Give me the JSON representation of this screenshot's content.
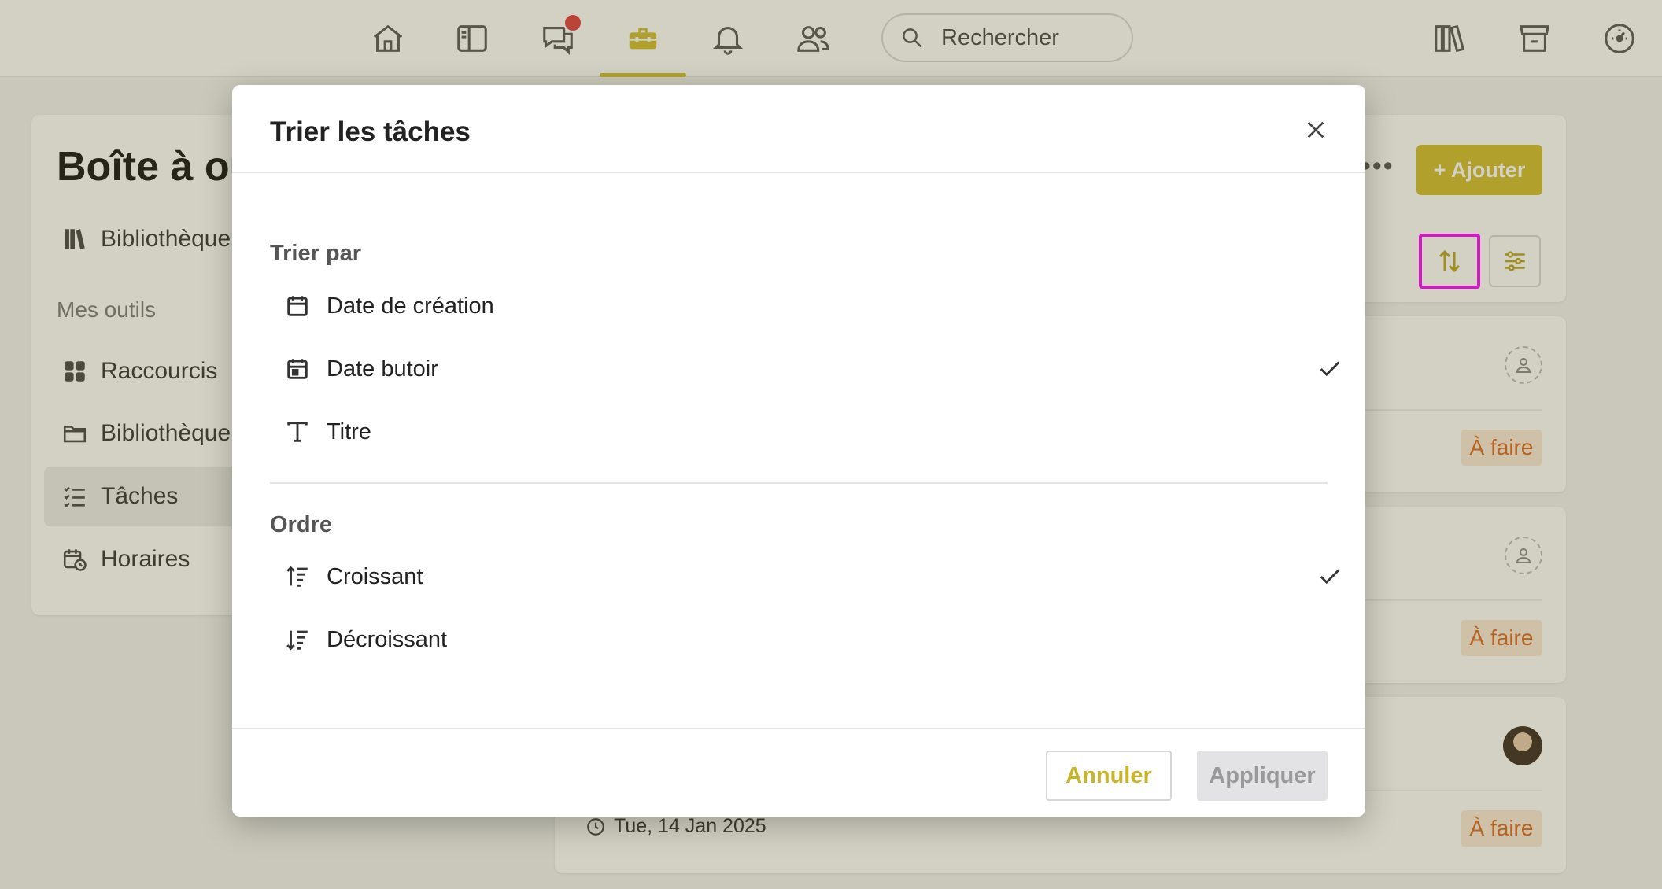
{
  "colors": {
    "accent": "#d1bd2f",
    "status_todo_text": "#d9661f",
    "status_todo_bg": "#fbe8da",
    "highlight": "#ff00ff",
    "notification": "#e03c3c"
  },
  "topbar": {
    "nav_icons": [
      "home-icon",
      "sidebar-panel-icon",
      "chat-icon",
      "toolbox-icon",
      "bell-icon",
      "people-icon"
    ],
    "active_nav": "toolbox-icon",
    "search_placeholder": "Rechercher",
    "right_icons": [
      "library-icon",
      "store-icon",
      "dashboard-gauge-icon"
    ]
  },
  "sidebar": {
    "title": "Boîte à ou",
    "top_item": "Bibliothèque",
    "section": "Mes outils",
    "items": [
      {
        "label": "Raccourcis",
        "icon": "grid-icon"
      },
      {
        "label": "Bibliothèque",
        "icon": "folder-icon"
      },
      {
        "label": "Tâches",
        "icon": "checklist-icon",
        "active": true
      },
      {
        "label": "Horaires",
        "icon": "calendar-clock-icon"
      }
    ]
  },
  "content": {
    "add_button": "+ Ajouter",
    "more": "•••",
    "status_labels": [
      "À faire",
      "À faire",
      "À faire"
    ],
    "due_date": "Tue, 14 Jan 2025"
  },
  "modal": {
    "title": "Trier les tâches",
    "sort_by_label": "Trier par",
    "sort_by_options": [
      {
        "label": "Date de création",
        "icon": "calendar-icon",
        "selected": false
      },
      {
        "label": "Date butoir",
        "icon": "calendar-event-icon",
        "selected": true
      },
      {
        "label": "Titre",
        "icon": "text-icon",
        "selected": false
      }
    ],
    "order_label": "Ordre",
    "order_options": [
      {
        "label": "Croissant",
        "icon": "sort-ascending-icon",
        "selected": true
      },
      {
        "label": "Décroissant",
        "icon": "sort-descending-icon",
        "selected": false
      }
    ],
    "cancel": "Annuler",
    "apply": "Appliquer"
  }
}
